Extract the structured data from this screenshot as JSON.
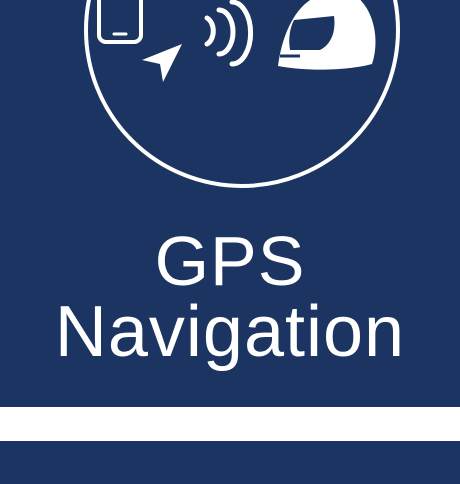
{
  "tile": {
    "title_line_1": "GPS",
    "title_line_2": "Navigation"
  },
  "emblem": {
    "icons": [
      "smartphone-icon",
      "navigation-arrow-icon",
      "wireless-signal-icon",
      "helmet-icon"
    ]
  },
  "colors": {
    "background": "#1c3461",
    "foreground": "#ffffff"
  }
}
